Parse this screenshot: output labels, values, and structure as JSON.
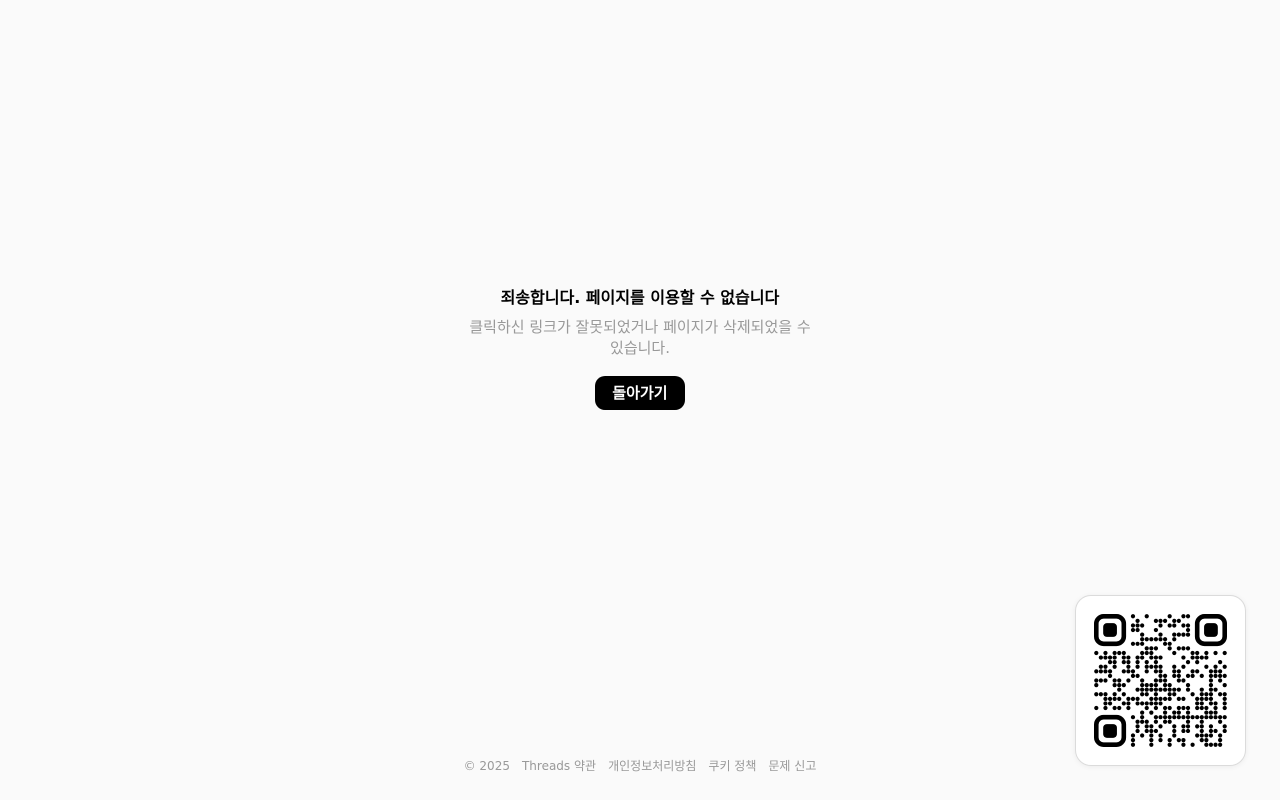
{
  "error": {
    "title": "죄송합니다. 페이지를 이용할 수 없습니다",
    "message": "클릭하신 링크가 잘못되었거나 페이지가 삭제되었을 수 있습니다.",
    "back_button_label": "돌아가기"
  },
  "footer": {
    "copyright": "© 2025",
    "links": [
      "Threads 약관",
      "개인정보처리방침",
      "쿠키 정책",
      "문제 신고"
    ]
  },
  "qr_code": {
    "icon": "qr-code-icon"
  },
  "colors": {
    "background": "#fafafa",
    "title": "#000000",
    "secondary_text": "#999999",
    "button_bg": "#000000",
    "button_text": "#ffffff"
  }
}
